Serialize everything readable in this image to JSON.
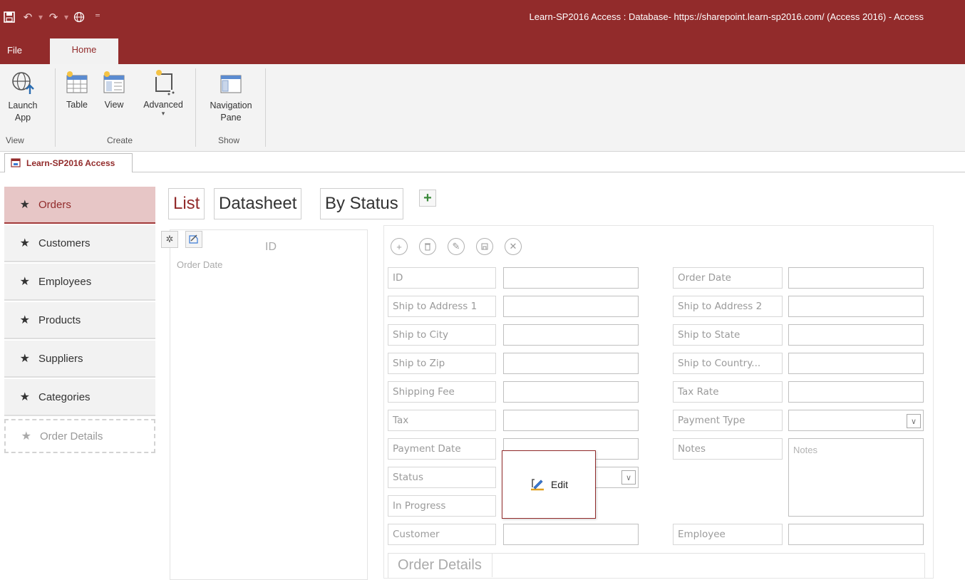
{
  "window": {
    "title": "Learn-SP2016 Access : Database- https://sharepoint.learn-sp2016.com/ (Access 2016) - Access"
  },
  "ribbon": {
    "tabs": [
      "File",
      "Home"
    ],
    "active_tab": "Home",
    "groups": {
      "view": {
        "label": "View",
        "buttons": [
          {
            "label": "Launch App",
            "icon": "globe-arrow-icon"
          }
        ]
      },
      "create": {
        "label": "Create",
        "buttons": [
          {
            "label": "Table",
            "icon": "table-icon"
          },
          {
            "label": "View",
            "icon": "view-icon"
          },
          {
            "label": "Advanced",
            "icon": "advanced-icon",
            "has_dropdown": true
          }
        ]
      },
      "show": {
        "label": "Show",
        "buttons": [
          {
            "label": "Navigation Pane",
            "icon": "navigation-pane-icon"
          }
        ]
      }
    }
  },
  "document_tab": {
    "label": "Learn-SP2016 Access"
  },
  "nav": {
    "items": [
      {
        "label": "Orders",
        "active": true
      },
      {
        "label": "Customers"
      },
      {
        "label": "Employees"
      },
      {
        "label": "Products"
      },
      {
        "label": "Suppliers"
      },
      {
        "label": "Categories"
      }
    ],
    "ghost_item": {
      "label": "Order Details"
    }
  },
  "views": {
    "tabs": [
      "List",
      "Datasheet",
      "By Status"
    ],
    "active": "List",
    "add_symbol": "+"
  },
  "list_panel": {
    "primary_field": "ID",
    "secondary_field": "Order Date"
  },
  "form": {
    "left_labels": [
      "ID",
      "Ship to Address 1",
      "Ship to City",
      "Ship to Zip",
      "Shipping Fee",
      "Tax",
      "Payment Date",
      "Status",
      "In Progress",
      "Customer"
    ],
    "right_labels": [
      "Order Date",
      "Ship to Address 2",
      "Ship to State",
      "Ship to Country...",
      "Tax Rate",
      "Payment Type",
      "Notes",
      "Employee"
    ],
    "notes_placeholder": "Notes",
    "subform_label": "Order Details"
  },
  "edit_popup": {
    "label": "Edit"
  },
  "colors": {
    "brand": "#922b2b",
    "nav_active_bg": "#e7c6c6",
    "add_green": "#3a8a3a"
  }
}
